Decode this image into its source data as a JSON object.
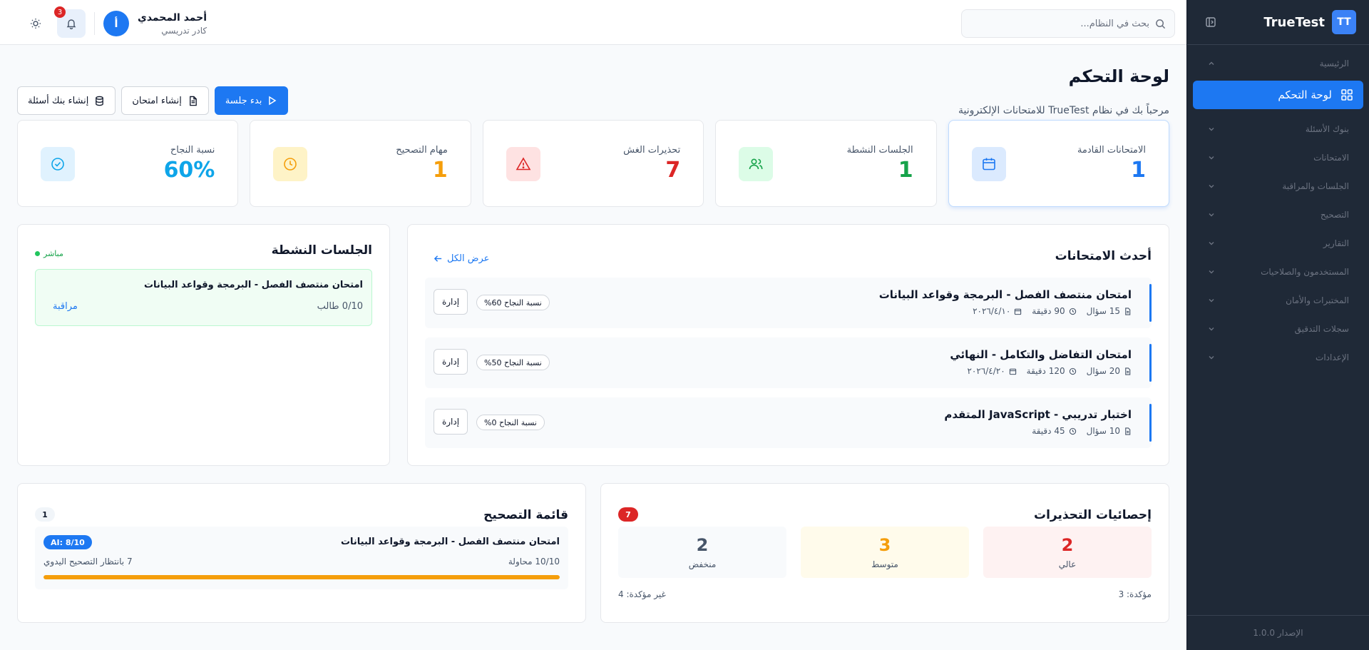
{
  "app": {
    "brand_badge": "TT",
    "brand_name": "TrueTest",
    "version": "الإصدار 1.0.0"
  },
  "sidebar": {
    "items": [
      {
        "label": "الرئيسية",
        "type": "group",
        "expanded": true
      },
      {
        "label": "لوحة التحكم",
        "type": "item",
        "active": true
      },
      {
        "label": "بنوك الأسئلة",
        "type": "group"
      },
      {
        "label": "الامتحانات",
        "type": "group"
      },
      {
        "label": "الجلسات والمراقبة",
        "type": "group"
      },
      {
        "label": "التصحيح",
        "type": "group"
      },
      {
        "label": "التقارير",
        "type": "group"
      },
      {
        "label": "المستخدمون والصلاحيات",
        "type": "group"
      },
      {
        "label": "المختبرات والأمان",
        "type": "group"
      },
      {
        "label": "سجلات التدقيق",
        "type": "group"
      },
      {
        "label": "الإعدادات",
        "type": "group"
      }
    ]
  },
  "header": {
    "search_placeholder": "بحث في النظام...",
    "notifications_count": "3",
    "user": {
      "initial": "أ",
      "name": "أحمد المحمدي",
      "role": "كادر تدريسي"
    }
  },
  "page": {
    "title": "لوحة التحكم",
    "subtitle": "مرحباً بك في نظام TrueTest للامتحانات الإلكترونية",
    "actions": {
      "create_bank": "إنشاء بنك أسئلة",
      "create_exam": "إنشاء امتحان",
      "start_session": "بدء جلسة"
    }
  },
  "stats": [
    {
      "label": "الامتحانات القادمة",
      "value": "1",
      "color": "#1d78f2",
      "icon": "calendar-icon"
    },
    {
      "label": "الجلسات النشطة",
      "value": "1",
      "color": "#16a34a",
      "icon": "users-icon"
    },
    {
      "label": "تحذيرات الغش",
      "value": "7",
      "color": "#dc2626",
      "icon": "alert-triangle-icon"
    },
    {
      "label": "مهام التصحيح",
      "value": "1",
      "color": "#f59e0b",
      "icon": "clock-icon"
    },
    {
      "label": "نسبة النجاح",
      "value": "60%",
      "color": "#0ea5e9",
      "icon": "check-circle-icon"
    }
  ],
  "recent_exams": {
    "title": "أحدث الامتحانات",
    "view_all": "عرض الكل",
    "manage_label": "إدارة",
    "items": [
      {
        "title": "امتحان منتصف الفصل - البرمجة وقواعد البيانات",
        "questions": "15 سؤال",
        "duration": "90 دقيقة",
        "date": "٢٠٢٦/٤/١٠",
        "pass_rate": "نسبة النجاح 60%"
      },
      {
        "title": "امتحان التفاضل والتكامل - النهائي",
        "questions": "20 سؤال",
        "duration": "120 دقيقة",
        "date": "٢٠٢٦/٤/٢٠",
        "pass_rate": "نسبة النجاح 50%"
      },
      {
        "title": "اختبار تدريبي - JavaScript المتقدم",
        "questions": "10 سؤال",
        "duration": "45 دقيقة",
        "date": "",
        "pass_rate": "نسبة النجاح 0%"
      }
    ]
  },
  "active_sessions": {
    "title": "الجلسات النشطة",
    "live": "مباشر",
    "session": {
      "title": "امتحان منتصف الفصل - البرمجة وقواعد البيانات",
      "students": "0/10 طالب",
      "monitor": "مراقبة"
    }
  },
  "warnings": {
    "title": "إحصائيات التحذيرات",
    "total": "7",
    "levels": [
      {
        "value": "2",
        "label": "عالي",
        "color": "#dc2626",
        "bg": "#fef2f2"
      },
      {
        "value": "3",
        "label": "متوسط",
        "color": "#f59e0b",
        "bg": "#fffbeb"
      },
      {
        "value": "2",
        "label": "منخفض",
        "color": "#475569",
        "bg": "#f8fafc"
      }
    ],
    "confirmed": "مؤكدة: 3",
    "unconfirmed": "غير مؤكدة: 4"
  },
  "grading": {
    "title": "قائمة التصحيح",
    "count": "1",
    "item": {
      "title": "امتحان منتصف الفصل - البرمجة وقواعد البيانات",
      "ai": "AI: 8/10",
      "attempts": "10/10 محاولة",
      "pending": "7 بانتظار التصحيح اليدوي",
      "progress": 1.0
    }
  }
}
